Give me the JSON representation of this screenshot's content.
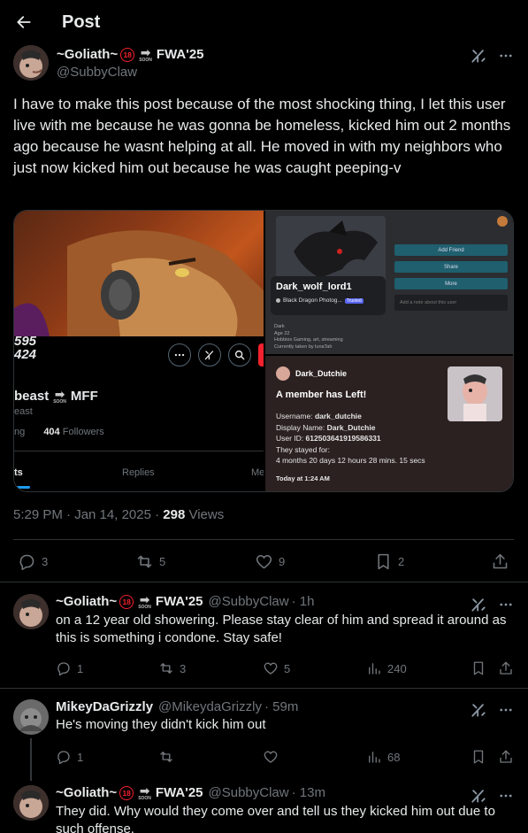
{
  "header": {
    "title": "Post"
  },
  "main_post": {
    "display_name": "~Goliath~",
    "badge_18": "18",
    "soon_label": "SOON",
    "name_suffix": "FWA'25",
    "handle": "@SubbyClaw",
    "text": "I have to make this post because of the most shocking thing, I let this user live with me because he was gonna be homeless, kicked him out 2 months ago because he wasnt helping at all. He moved in with my neighbors who just now kicked him out because he was caught peeping-v",
    "timestamp": "5:29 PM · Jan 14, 2025 · ",
    "views_count": "298",
    "views_label": " Views",
    "stats": {
      "replies": "3",
      "reposts": "5",
      "likes": "9",
      "bookmarks": "2"
    }
  },
  "media": {
    "left": {
      "stat_a": "595",
      "stat_b": "424",
      "name_partial": "beast",
      "name_suffix": "MFF",
      "handle_partial": "east",
      "following_partial": "ng",
      "followers_count": "404",
      "followers_label": "Followers",
      "tab_posts_partial": "ts",
      "tab_replies": "Replies",
      "tab_media_partial": "Me"
    },
    "right_top": {
      "username": "Dark_wolf_lord1",
      "tagline": "Black Dragon Photog...",
      "trusted": "Trusted",
      "add_friend": "Add Friend",
      "share": "Share",
      "more": "More",
      "note_placeholder": "Add a note about this user",
      "bio_lines": [
        "Dark",
        "Age 22",
        "Hobbies Gaming, art, streaming",
        "Currently taken by lunaTah"
      ]
    },
    "right_bottom": {
      "user": "Dark_Dutchie",
      "title": "A member has Left!",
      "username_label": "Username:",
      "username_value": "dark_dutchie",
      "display_label": "Display Name:",
      "display_value": "Dark_Dutchie",
      "userid_label": "User ID:",
      "userid_value": "612503641919586331",
      "stayed_label": "They stayed for:",
      "stayed_value": "4 months 20 days 12 hours 28 mins. 15 secs",
      "footer": "Today at 1:24 AM"
    }
  },
  "replies": [
    {
      "display_name": "~Goliath~",
      "badge_18": "18",
      "soon_label": "SOON",
      "name_suffix": "FWA'25",
      "handle": "@SubbyClaw",
      "time": " · 1h",
      "text": "on a 12 year old showering. Please stay clear of him and spread it around as this is something i condone.  Stay safe!",
      "replies": "1",
      "reposts": "3",
      "likes": "5",
      "views": "240"
    },
    {
      "display_name": "MikeyDaGrizzly",
      "handle": "@MikeydaGrizzly",
      "time": " · 59m",
      "text": "He's moving they didn't kick him out",
      "replies": "1",
      "reposts": "",
      "likes": "",
      "views": "68"
    },
    {
      "display_name": "~Goliath~",
      "badge_18": "18",
      "soon_label": "SOON",
      "name_suffix": "FWA'25",
      "handle": "@SubbyClaw",
      "time": " · 13m",
      "text": "They did.  Why would they come over and tell us they kicked him out due to such offense."
    }
  ],
  "colors": {
    "background": "#000000",
    "text": "#e7e9ea",
    "muted": "#71767b",
    "divider": "#2f3336",
    "badge_red": "#f4212e"
  }
}
